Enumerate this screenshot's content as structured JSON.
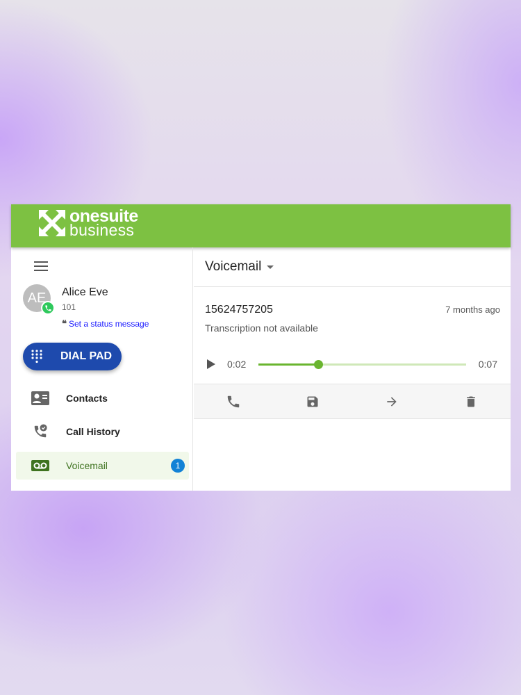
{
  "brand": {
    "line1": "onesuite",
    "line2": "business",
    "color": "#7dc142"
  },
  "user": {
    "initials": "AE",
    "name": "Alice Eve",
    "extension": "101",
    "status_link": "Set a status message",
    "status_quote": "❝"
  },
  "dial_pad": {
    "label": "DIAL PAD",
    "icon": "dialpad-icon"
  },
  "nav": [
    {
      "label": "Contacts",
      "icon": "contacts-icon"
    },
    {
      "label": "Call History",
      "icon": "call-history-icon"
    },
    {
      "label": "Voicemail",
      "icon": "voicemail-icon",
      "badge": "1",
      "active": true
    }
  ],
  "main": {
    "title": "Voicemail",
    "voicemail": {
      "number": "15624757205",
      "time_ago": "7 months ago",
      "transcription": "Transcription not available",
      "player": {
        "current": "0:02",
        "duration": "0:07",
        "progress_fraction": 0.286
      }
    },
    "actions": [
      "call-icon",
      "save-icon",
      "forward-icon",
      "delete-icon"
    ]
  }
}
